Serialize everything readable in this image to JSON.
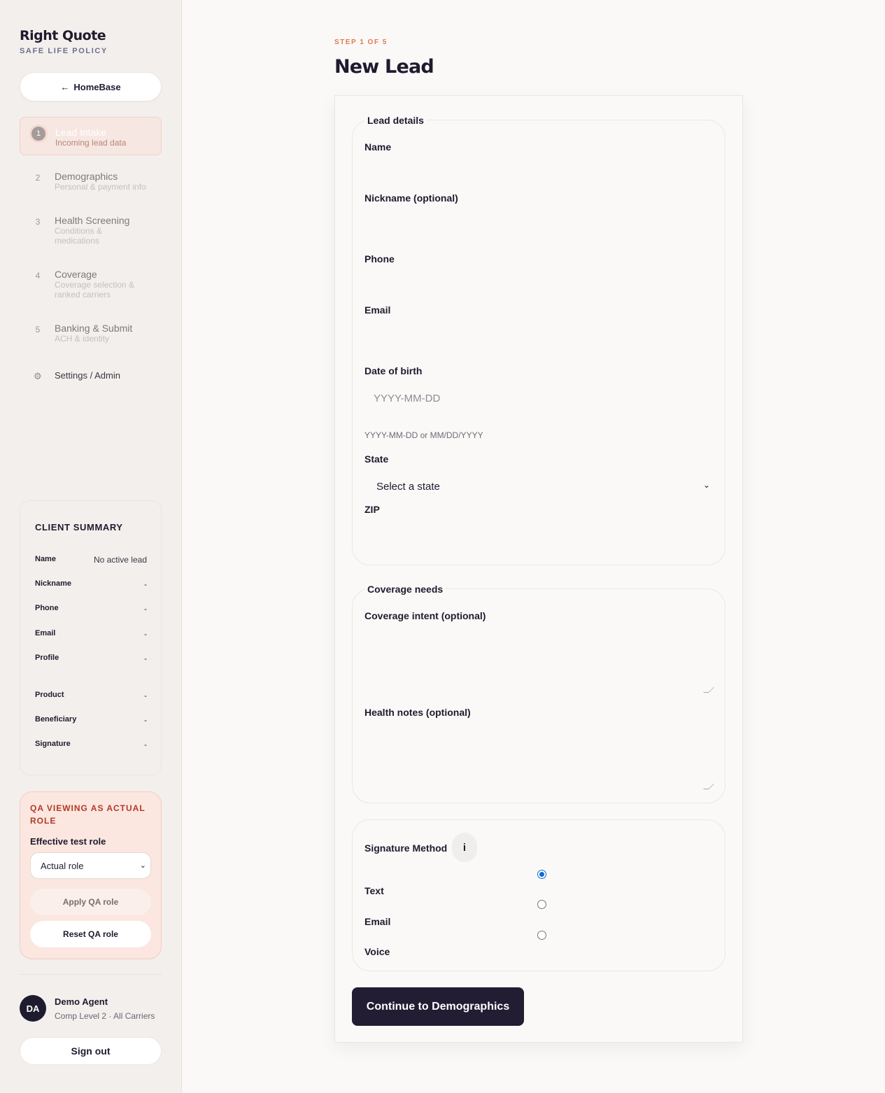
{
  "brand": {
    "name": "Right Quote",
    "subtitle": "SAFE LIFE POLICY"
  },
  "sidebar": {
    "home_label": "HomeBase",
    "home_arrow": "←",
    "steps": [
      {
        "num": "1",
        "title": "Lead Intake",
        "sub": "Incoming lead data",
        "active": true
      },
      {
        "num": "2",
        "title": "Demographics",
        "sub": "Personal & payment info"
      },
      {
        "num": "3",
        "title": "Health Screening",
        "sub": "Conditions & medications"
      },
      {
        "num": "4",
        "title": "Coverage",
        "sub": "Coverage selection & ranked carriers"
      },
      {
        "num": "5",
        "title": "Banking & Submit",
        "sub": "ACH & identity"
      }
    ],
    "settings_icon": "⚙",
    "settings_label": "Settings / Admin"
  },
  "summary": {
    "heading": "CLIENT SUMMARY",
    "rows": [
      {
        "k": "Name",
        "v": "No active lead"
      },
      {
        "k": "Nickname",
        "v": "-"
      },
      {
        "k": "Phone",
        "v": "-"
      },
      {
        "k": "Email",
        "v": "-"
      },
      {
        "k": "Profile",
        "v": "-"
      },
      {
        "k": "Product",
        "v": "-"
      },
      {
        "k": "Beneficiary",
        "v": "-"
      },
      {
        "k": "Signature",
        "v": "-"
      }
    ]
  },
  "qa": {
    "title": "QA VIEWING AS ACTUAL ROLE",
    "role_label": "Effective test role",
    "role_value": "Actual role",
    "apply_label": "Apply QA role",
    "reset_label": "Reset QA role"
  },
  "agent": {
    "initials": "DA",
    "name": "Demo Agent",
    "meta": "Comp Level 2 · All Carriers",
    "signout": "Sign out"
  },
  "main": {
    "step_label": "STEP 1 OF 5",
    "title": "New Lead",
    "lead_details": {
      "legend": "Lead details",
      "name_label": "Name",
      "nickname_label": "Nickname (optional)",
      "phone_label": "Phone",
      "email_label": "Email",
      "dob_label": "Date of birth",
      "dob_placeholder": "YYYY-MM-DD",
      "dob_hint": "YYYY-MM-DD or MM/DD/YYYY",
      "state_label": "State",
      "state_value": "Select a state",
      "zip_label": "ZIP"
    },
    "coverage_needs": {
      "legend": "Coverage needs",
      "intent_label": "Coverage intent (optional)",
      "health_label": "Health notes (optional)"
    },
    "signature": {
      "label": "Signature Method",
      "info_icon": "i",
      "options": [
        {
          "label": "Text",
          "checked": true
        },
        {
          "label": "Email",
          "checked": false
        },
        {
          "label": "Voice",
          "checked": false
        }
      ]
    },
    "continue_label": "Continue to Demographics"
  }
}
